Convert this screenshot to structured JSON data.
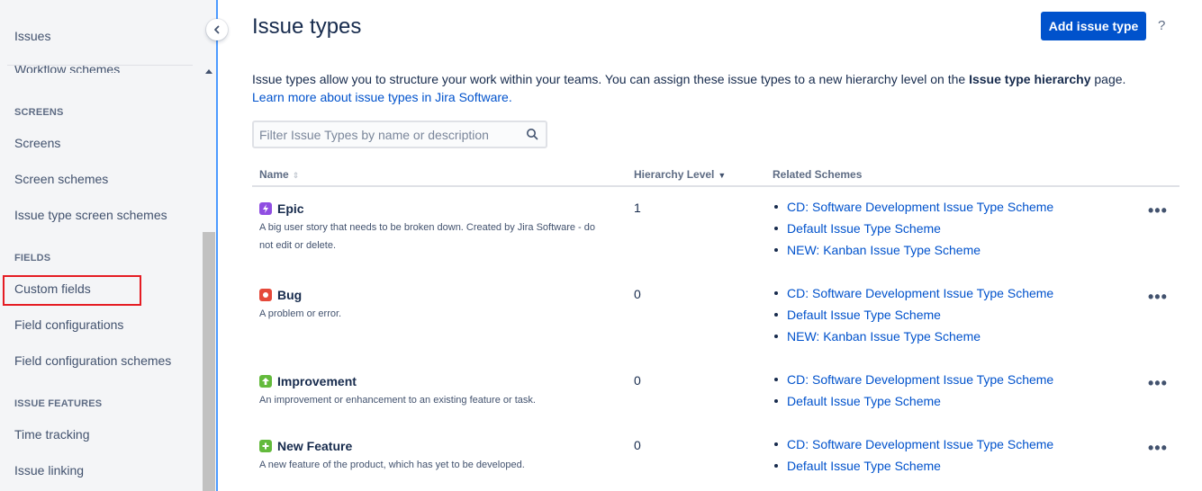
{
  "sidebar": {
    "top_item": "Issues",
    "cut_item": "Workflow schemes",
    "sections": [
      {
        "heading": "SCREENS",
        "items": [
          "Screens",
          "Screen schemes",
          "Issue type screen schemes"
        ]
      },
      {
        "heading": "FIELDS",
        "items": [
          "Custom fields",
          "Field configurations",
          "Field configuration schemes"
        ]
      },
      {
        "heading": "ISSUE FEATURES",
        "items": [
          "Time tracking",
          "Issue linking"
        ]
      }
    ]
  },
  "header": {
    "title": "Issue types",
    "add_button": "Add issue type",
    "help": "?"
  },
  "intro": {
    "text_before": "Issue types allow you to structure your work within your teams. You can assign these issue types to a new hierarchy level on the ",
    "bold": "Issue type hierarchy",
    "text_after": " page. ",
    "link": "Learn more about issue types in Jira Software."
  },
  "filter": {
    "placeholder": "Filter Issue Types by name or description"
  },
  "table": {
    "columns": [
      "Name",
      "Hierarchy Level",
      "Related Schemes"
    ],
    "rows": [
      {
        "name": "Epic",
        "icon": "lightning-icon",
        "color": "#904ee2",
        "description": "A big user story that needs to be broken down. Created by Jira Software - do not edit or delete.",
        "hierarchy": "1",
        "schemes": [
          "CD: Software Development Issue Type Scheme",
          "Default Issue Type Scheme",
          "NEW: Kanban Issue Type Scheme"
        ]
      },
      {
        "name": "Bug",
        "icon": "bug-icon",
        "color": "#e5493a",
        "description": "A problem or error.",
        "hierarchy": "0",
        "schemes": [
          "CD: Software Development Issue Type Scheme",
          "Default Issue Type Scheme",
          "NEW: Kanban Issue Type Scheme"
        ]
      },
      {
        "name": "Improvement",
        "icon": "arrow-up-icon",
        "color": "#63ba3c",
        "description": "An improvement or enhancement to an existing feature or task.",
        "hierarchy": "0",
        "schemes": [
          "CD: Software Development Issue Type Scheme",
          "Default Issue Type Scheme"
        ]
      },
      {
        "name": "New Feature",
        "icon": "plus-icon",
        "color": "#63ba3c",
        "description": "A new feature of the product, which has yet to be developed.",
        "hierarchy": "0",
        "schemes": [
          "CD: Software Development Issue Type Scheme",
          "Default Issue Type Scheme"
        ]
      }
    ],
    "more_label": "•••"
  }
}
